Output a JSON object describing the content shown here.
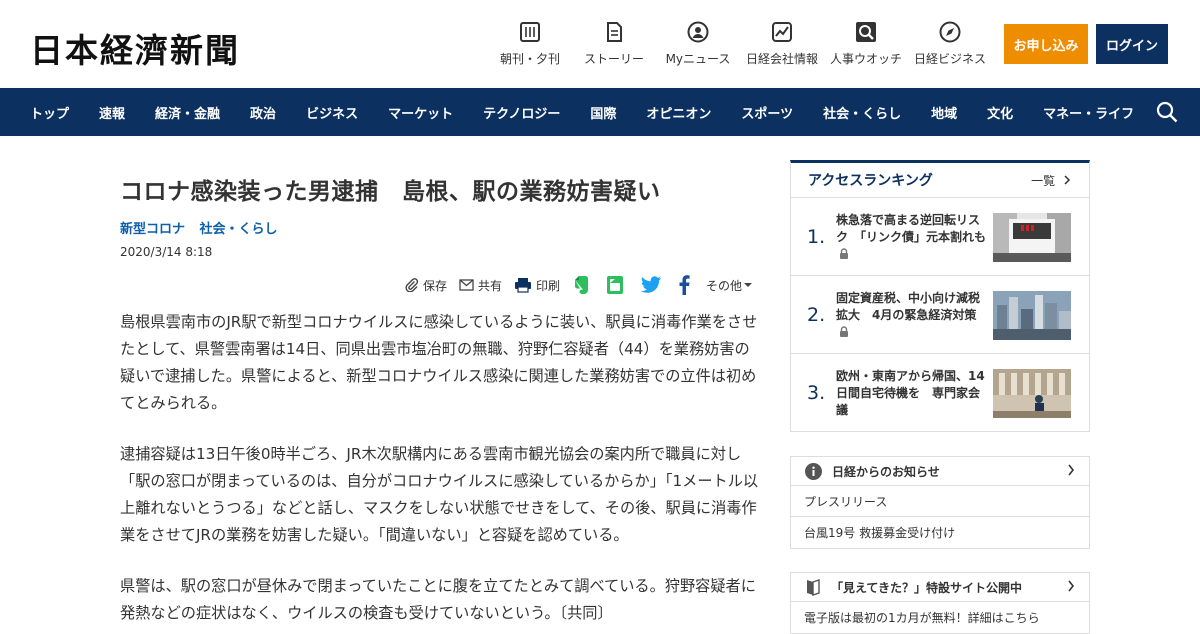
{
  "header": {
    "logo": "日本経濟新聞",
    "nav": [
      {
        "label": "朝刊・夕刊",
        "icon": "newspaper-icon"
      },
      {
        "label": "ストーリー",
        "icon": "document-icon"
      },
      {
        "label": "Myニュース",
        "icon": "person-icon"
      },
      {
        "label": "日経会社情報",
        "icon": "chart-icon"
      },
      {
        "label": "人事ウオッチ",
        "icon": "magnifier-icon"
      },
      {
        "label": "日経ビジネス",
        "icon": "compass-icon"
      }
    ],
    "apply_label": "お申し込み",
    "login_label": "ログイン"
  },
  "navbar": {
    "items": [
      "トップ",
      "速報",
      "経済・金融",
      "政治",
      "ビジネス",
      "マーケット",
      "テクノロジー",
      "国際",
      "オピニオン",
      "スポーツ",
      "社会・くらし",
      "地域",
      "文化",
      "マネー・ライフ"
    ]
  },
  "article": {
    "title": "コロナ感染装った男逮捕　島根、駅の業務妨害疑い",
    "topics": [
      "新型コロナ",
      "社会・くらし"
    ],
    "date": "2020/3/14 8:18",
    "share": {
      "save": "保存",
      "share": "共有",
      "print": "印刷",
      "other": "その他"
    },
    "paragraphs": [
      "島根県雲南市のJR駅で新型コロナウイルスに感染しているように装い、駅員に消毒作業をさせたとして、県警雲南署は14日、同県出雲市塩冶町の無職、狩野仁容疑者（44）を業務妨害の疑いで逮捕した。県警によると、新型コロナウイルス感染に関連した業務妨害での立件は初めてとみられる。",
      "逮捕容疑は13日午後0時半ごろ、JR木次駅構内にある雲南市観光協会の案内所で職員に対し「駅の窓口が閉まっているのは、自分がコロナウイルスに感染しているからか」「1メートル以上離れないとうつる」などと話し、マスクをしない状態でせきをして、その後、駅員に消毒作業をさせてJRの業務を妨害した疑い。「間違いない」と容疑を認めている。",
      "県警は、駅の窓口が昼休みで閉まっていたことに腹を立てたとみて調べている。狩野容疑者に発熱などの症状はなく、ウイルスの検査も受けていないという。〔共同〕"
    ]
  },
  "ranking": {
    "title": "アクセスランキング",
    "more": "一覧",
    "items": [
      {
        "num": "1.",
        "text": "株急落で高まる逆回転リスク　「リンク債」元本割れも"
      },
      {
        "num": "2.",
        "text": "固定資産税、中小向け減税拡大　4月の緊急経済対策"
      },
      {
        "num": "3.",
        "text": "欧州・東南アから帰国、14日間自宅待機を　専門家会議"
      }
    ]
  },
  "notices": {
    "title": "日経からのお知らせ",
    "items": [
      "プレスリリース",
      "台風19号 救援募金受け付け"
    ]
  },
  "special": {
    "title": "「見えてきた？」特設サイト公開中",
    "items": [
      "電子版は最初の1カ月が無料！詳細はこちら"
    ]
  },
  "colors": {
    "navy": "#0c3060",
    "orange": "#ef8d00",
    "link": "#0c5fa8"
  }
}
